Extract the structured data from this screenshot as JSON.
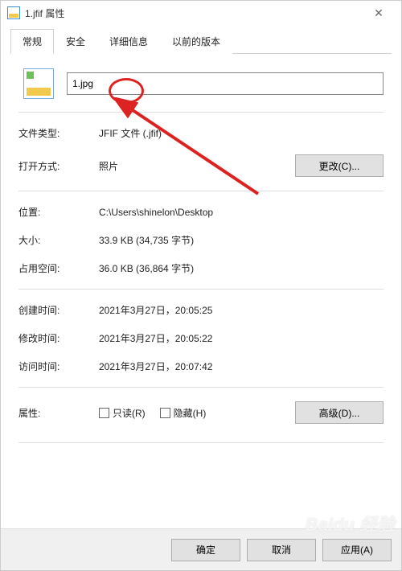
{
  "window": {
    "title": "1.jfif 属性",
    "close_glyph": "✕"
  },
  "tabs": {
    "general": "常规",
    "security": "安全",
    "details": "详细信息",
    "previous": "以前的版本"
  },
  "filename": {
    "value": "1.jpg"
  },
  "labels": {
    "filetype": "文件类型:",
    "opens_with": "打开方式:",
    "location": "位置:",
    "size": "大小:",
    "size_on_disk": "占用空间:",
    "created": "创建时间:",
    "modified": "修改时间:",
    "accessed": "访问时间:",
    "attributes": "属性:"
  },
  "values": {
    "filetype": "JFIF 文件 (.jfif)",
    "opens_with": "照片",
    "location": "C:\\Users\\shinelon\\Desktop",
    "size": "33.9 KB (34,735 字节)",
    "size_on_disk": "36.0 KB (36,864 字节)",
    "created": "2021年3月27日，20:05:25",
    "modified": "2021年3月27日，20:05:22",
    "accessed": "2021年3月27日，20:07:42"
  },
  "buttons": {
    "change": "更改(C)...",
    "advanced": "高级(D)...",
    "ok": "确定",
    "cancel": "取消",
    "apply": "应用(A)"
  },
  "checkboxes": {
    "readonly": "只读(R)",
    "hidden": "隐藏(H)"
  },
  "watermark": "Baidu 经验"
}
